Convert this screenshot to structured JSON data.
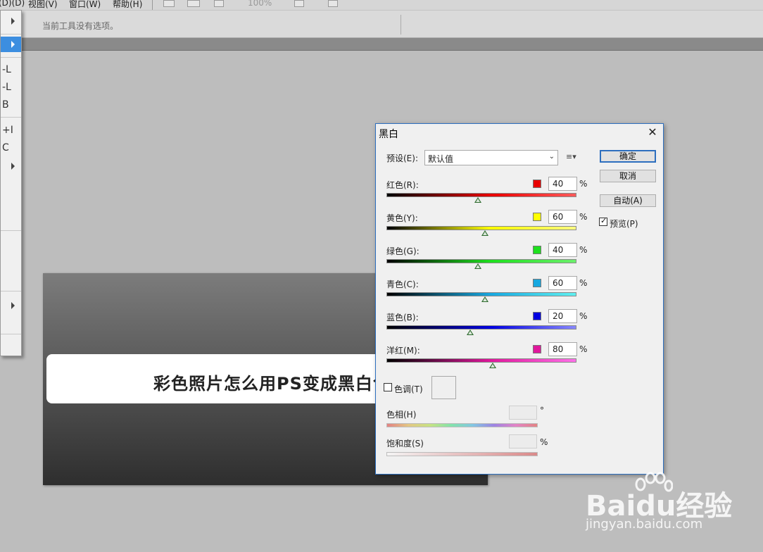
{
  "menubar": {
    "items": [
      "(D)(D)",
      "视图(V)",
      "窗口(W)",
      "帮助(H)"
    ],
    "zoom": "100%"
  },
  "options_bar": {
    "message": "当前工具没有选项。"
  },
  "left_menu": {
    "shortcuts": [
      "-L",
      "-L",
      "B",
      "+I",
      "C"
    ]
  },
  "canvas": {
    "caption": "彩色照片怎么用PS变成黑白色"
  },
  "dialog": {
    "title": "黑白",
    "close": "✕",
    "preset_label": "预设(E):",
    "preset_value": "默认值",
    "buttons": {
      "ok": "确定",
      "cancel": "取消",
      "auto": "自动(A)"
    },
    "preview_label": "预览(P)",
    "preview_checked": true,
    "channels": [
      {
        "label": "红色(R):",
        "value": "40",
        "swatch": "#e80000",
        "gradient_end": "#ff5a5a",
        "fraction": 0.48
      },
      {
        "label": "黄色(Y):",
        "value": "60",
        "swatch": "#ffff00",
        "gradient_end": "#ffff80",
        "fraction": 0.52
      },
      {
        "label": "绿色(G):",
        "value": "40",
        "swatch": "#1ee01e",
        "gradient_end": "#6cf06c",
        "fraction": 0.48
      },
      {
        "label": "青色(C):",
        "value": "60",
        "swatch": "#18a8e0",
        "gradient_end": "#60f0f0",
        "fraction": 0.52
      },
      {
        "label": "蓝色(B):",
        "value": "20",
        "swatch": "#0000e0",
        "gradient_end": "#8888ff",
        "fraction": 0.44
      },
      {
        "label": "洋红(M):",
        "value": "80",
        "swatch": "#e0189c",
        "gradient_end": "#ff70e8",
        "fraction": 0.56
      }
    ],
    "percent": "%",
    "tint_label": "色调(T)",
    "tint_checked": false,
    "hue_label": "色相(H)",
    "hue_unit": "°",
    "saturation_label": "饱和度(S)",
    "saturation_unit": "%"
  },
  "watermark": {
    "brand_a": "Bai",
    "brand_b": "du",
    "brand_c": "经验",
    "url": "jingyan.baidu.com"
  }
}
